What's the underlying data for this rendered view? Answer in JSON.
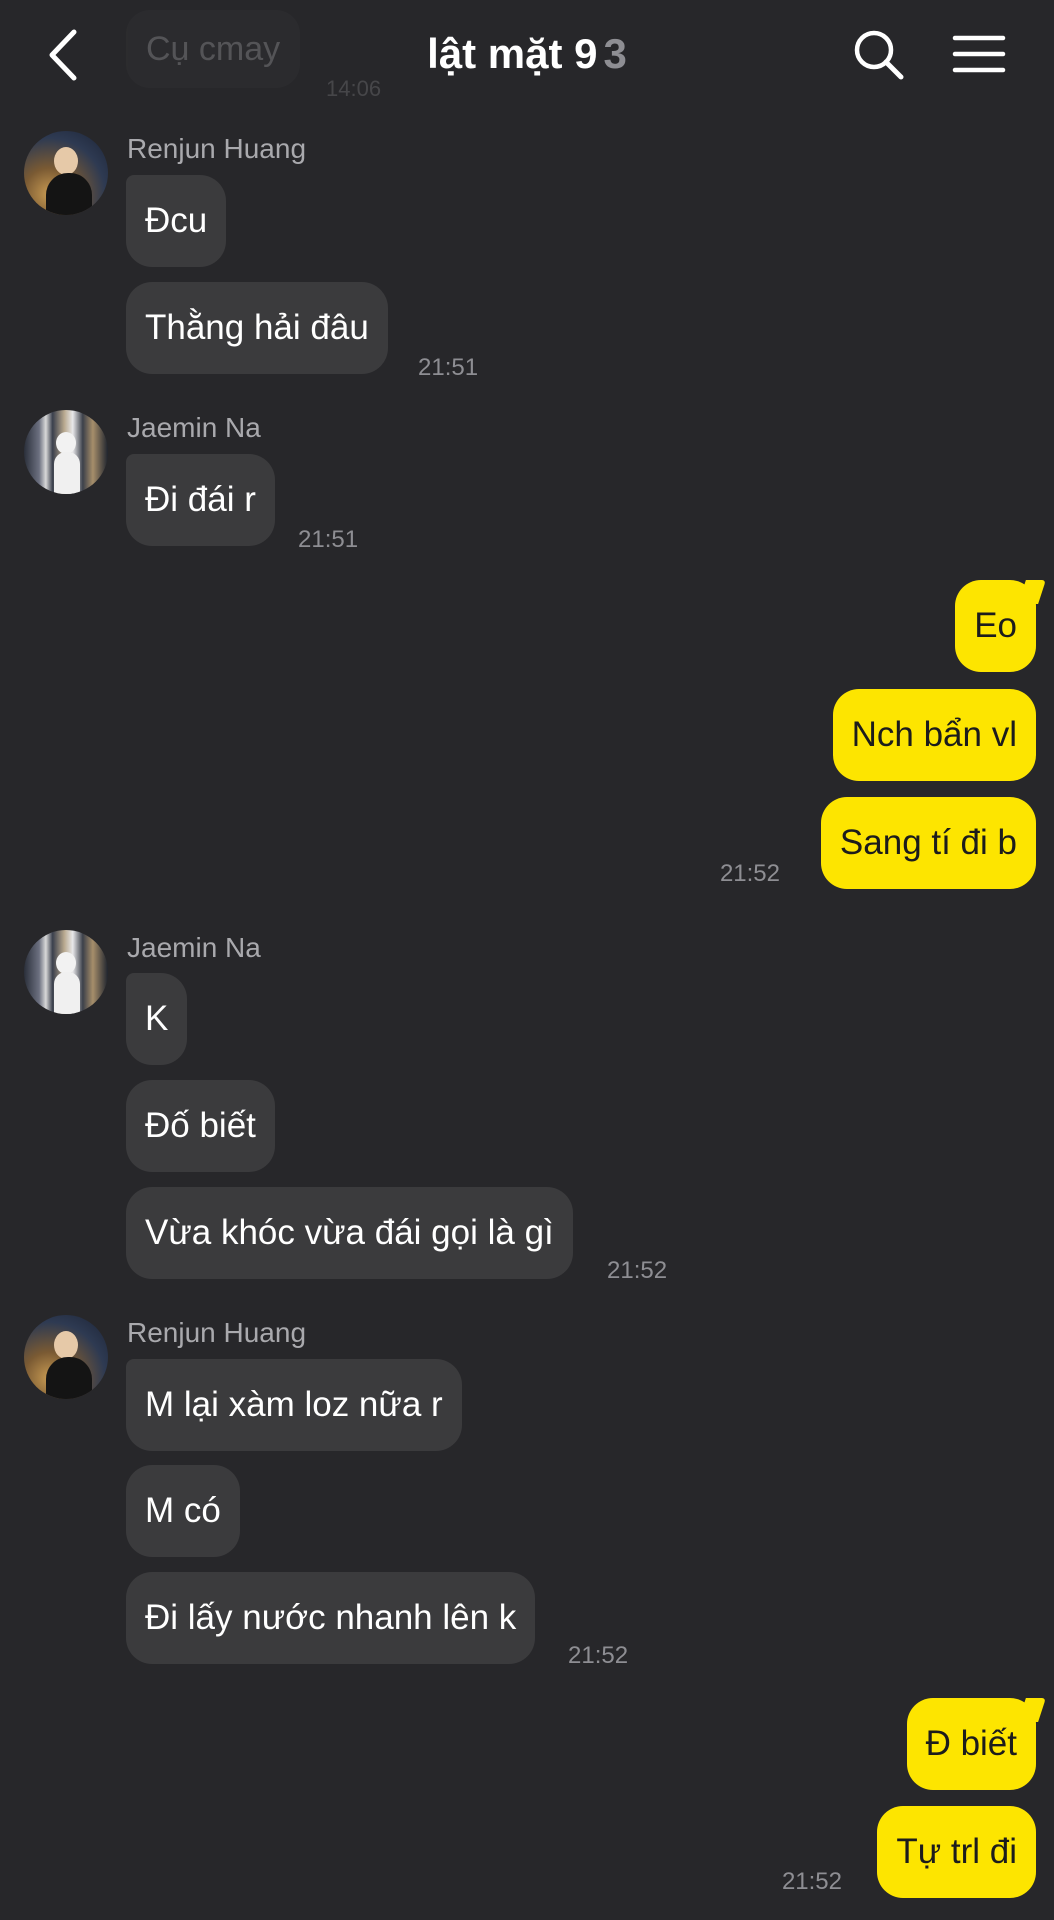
{
  "header": {
    "title": "lật mặt 9",
    "member_count": "3",
    "back_icon": "chevron-left-icon",
    "search_icon": "search-icon",
    "menu_icon": "hamburger-menu-icon",
    "ghost_message": "Cụ cmay",
    "ghost_time": "14:06"
  },
  "colors": {
    "background": "#27272a",
    "incoming_bubble": "#3b3b3d",
    "outgoing_bubble": "#fde500"
  },
  "messages": {
    "g1": {
      "sender": "Renjun Huang",
      "avatar": "avatar-renjun",
      "m1": "Đcu",
      "m2": "Thằng hải đâu",
      "time": "21:51"
    },
    "g2": {
      "sender": "Jaemin Na",
      "avatar": "avatar-jaemin",
      "m1": "Đi đái r",
      "time": "21:51"
    },
    "g3": {
      "m1": "Eo",
      "m2": "Nch bẩn vl",
      "m3": "Sang tí đi b",
      "time": "21:52"
    },
    "g4": {
      "sender": "Jaemin Na",
      "avatar": "avatar-jaemin",
      "m1": "K",
      "m2": "Đố biết",
      "m3": "Vừa khóc vừa đái gọi là gì",
      "time": "21:52"
    },
    "g5": {
      "sender": "Renjun Huang",
      "avatar": "avatar-renjun",
      "m1": "M lại xàm loz nữa r",
      "m2": "M có",
      "m3": "Đi lấy nước nhanh lên k",
      "time": "21:52"
    },
    "g6": {
      "m1": "Đ biết",
      "m2": "Tự trl đi",
      "time": "21:52"
    }
  }
}
